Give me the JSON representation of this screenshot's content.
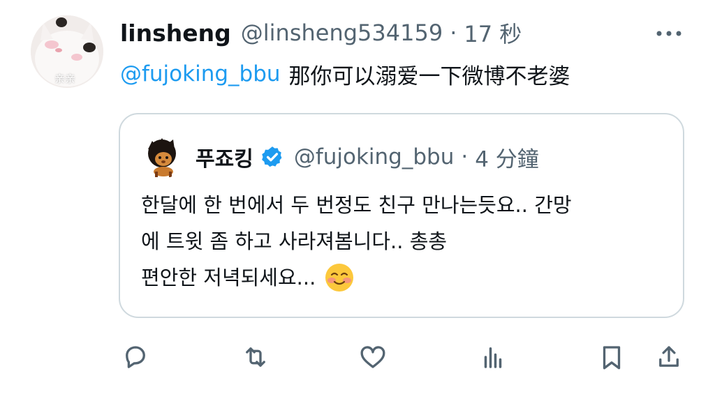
{
  "tweet": {
    "avatar_caption": "亲亲",
    "display_name": "linsheng",
    "handle": "@linsheng534159",
    "separator": "·",
    "time": "17 秒",
    "mention": "@fujoking_bbu",
    "text": "那你可以溺爱一下微博不老婆"
  },
  "quoted": {
    "display_name": "푸죠킹",
    "handle": "@fujoking_bbu",
    "separator": "·",
    "time": "4 分鐘",
    "lines": [
      "한달에 한 번에서 두 번정도 친구 만나는듯요.. 간망",
      "에 트윗 좀 하고 사라져봄니다.. 총총",
      "편안한 저녁되세요..."
    ]
  },
  "icons": {
    "more": "more-icon",
    "verified": "verified-badge-icon",
    "reply": "reply-icon",
    "retweet": "retweet-icon",
    "like": "like-icon",
    "views": "views-icon",
    "bookmark": "bookmark-icon",
    "share": "share-icon",
    "emoji": "smiling-face-emoji"
  },
  "colors": {
    "text_primary": "#0f1419",
    "text_secondary": "#536471",
    "accent": "#1d9bf0",
    "border": "#cfd9de"
  }
}
